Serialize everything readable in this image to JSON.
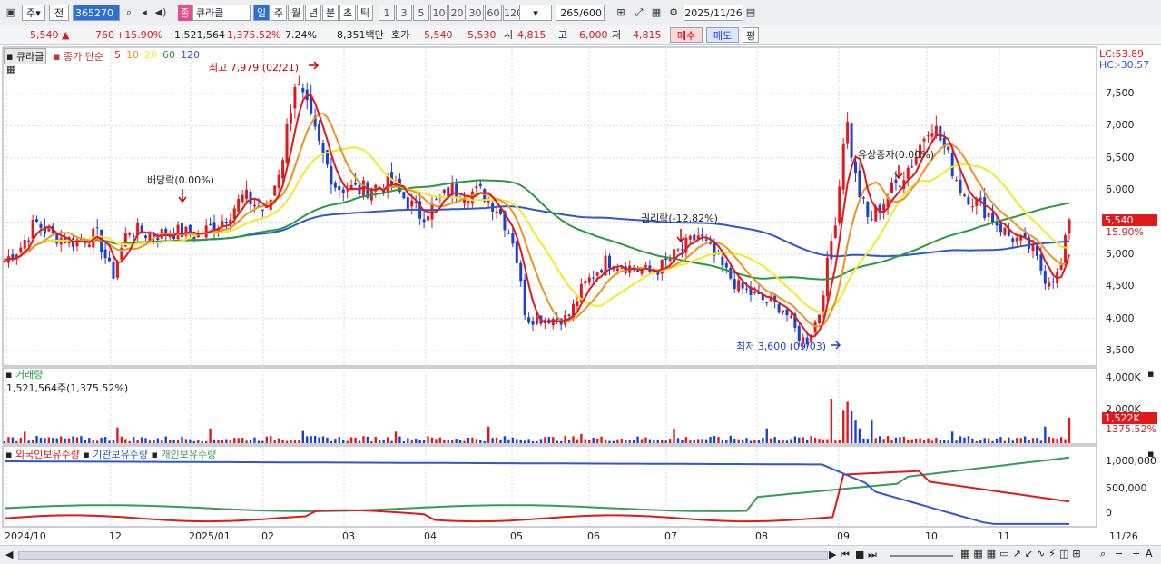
{
  "toolbar": {
    "mode_day": "주",
    "mode_prev": "전",
    "code": "365270",
    "name_badge": "종",
    "name": "큐라클",
    "periods": [
      "일",
      "주",
      "월",
      "년",
      "분",
      "초",
      "틱"
    ],
    "active_period": "일",
    "nums": [
      "1",
      "3",
      "5",
      "10",
      "20",
      "30",
      "60",
      "120"
    ],
    "count": "265",
    "count_total": "/600",
    "date": "2025/11/26"
  },
  "info": {
    "price": "5,540",
    "change": "760",
    "change_pct": "+15.90%",
    "volume": "1,521,564",
    "vol_ratio": "1,375.52%",
    "turnover": "7.24%",
    "amount": "8,351백만",
    "quote_label": "호가",
    "ask": "5,540",
    "bid": "5,530",
    "open_label": "시",
    "open": "4,815",
    "high_label": "고",
    "high": "6,000",
    "low_label": "저",
    "low": "4,815",
    "buy": "매수",
    "sell": "매도",
    "eval": "평"
  },
  "price_panel": {
    "stock_tag": "큐라클",
    "ma_label": "종가 단순",
    "ma_periods": [
      "5",
      "10",
      "20",
      "60",
      "120"
    ],
    "lc": "LC:53.89",
    "hc": "HC:-30.57",
    "high_note": "최고 7,979 (02/21)",
    "low_note": "최저 3,600 (09/03)",
    "events": [
      "배당락(0.00%)",
      "권리락(-12.82%)",
      "유상증자(0.00%)"
    ],
    "y_ticks": [
      "7,500",
      "7,000",
      "6,500",
      "6,000",
      "5,500",
      "5,000",
      "4,500",
      "4,000",
      "3,500"
    ],
    "last_price": "5,540",
    "last_pct": "15.90%"
  },
  "volume_panel": {
    "title": "거래량",
    "current": "1,521,564주(1,375.52%)",
    "y_ticks": [
      "4,000K",
      "2,000K"
    ],
    "last_vol": "1,522K",
    "last_pct": "1375.52%"
  },
  "holding_panel": {
    "legend": [
      "외국인보유수량",
      "기관보유수량",
      "개인보유수량"
    ],
    "y_ticks": [
      "1,000,000",
      "500,000",
      "0"
    ]
  },
  "x_axis": {
    "labels": [
      "2024/10",
      "12",
      "2025/01",
      "02",
      "03",
      "04",
      "05",
      "06",
      "07",
      "08",
      "09",
      "10",
      "11"
    ],
    "last_date": "11/26"
  },
  "colors": {
    "up": "#e0191c",
    "down": "#1b3fd1",
    "ma5": "#e0191c",
    "ma10": "#f0921e",
    "ma20": "#f7e826",
    "ma60": "#2a9a3c",
    "ma120": "#2f56d6",
    "foreign": "#e0191c",
    "institution": "#2f56d6",
    "individual": "#3a9a5b"
  }
}
